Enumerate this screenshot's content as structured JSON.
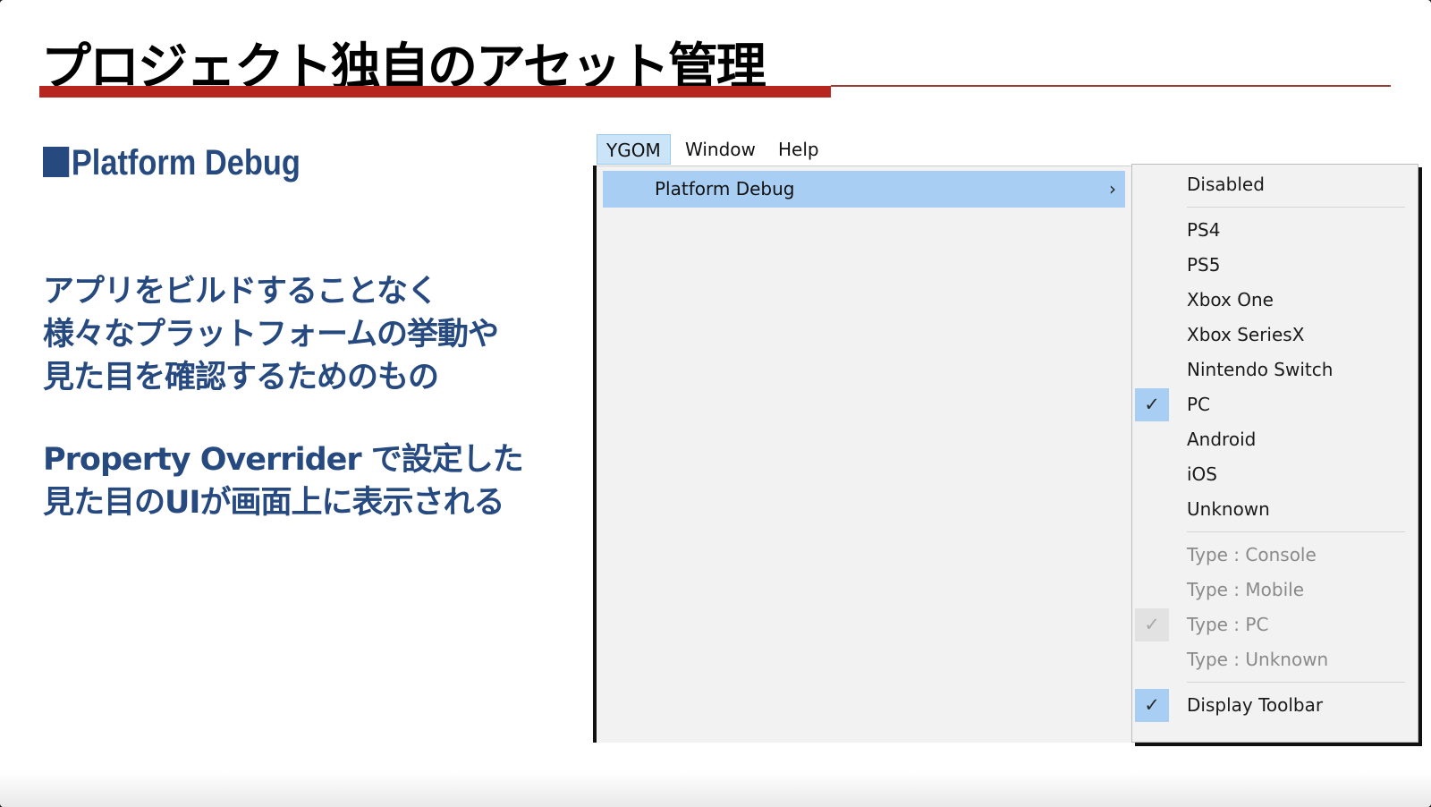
{
  "slide": {
    "title": "プロジェクト独自のアセット管理",
    "section_heading": "Platform Debug",
    "description_1": [
      "アプリをビルドすることなく",
      "様々なプラットフォームの挙動や",
      "見た目を確認するためのもの"
    ],
    "description_2": [
      "Property Overrider で設定した",
      "見た目のUIが画面上に表示される"
    ],
    "accent_color": "#b7251f",
    "text_color": "#264a80"
  },
  "menubar": {
    "items": [
      {
        "label": "YGOM",
        "active": true
      },
      {
        "label": "Window",
        "active": false
      },
      {
        "label": "Help",
        "active": false
      }
    ]
  },
  "main_menu": {
    "item": "Platform Debug",
    "arrow": "chevron-right-icon"
  },
  "submenu": {
    "items": [
      {
        "label": "Disabled",
        "checked": false,
        "enabled": true
      },
      {
        "label": "PS4",
        "checked": false,
        "enabled": true
      },
      {
        "label": "PS5",
        "checked": false,
        "enabled": true
      },
      {
        "label": "Xbox One",
        "checked": false,
        "enabled": true
      },
      {
        "label": "Xbox SeriesX",
        "checked": false,
        "enabled": true
      },
      {
        "label": "Nintendo Switch",
        "checked": false,
        "enabled": true
      },
      {
        "label": "PC",
        "checked": true,
        "enabled": true
      },
      {
        "label": "Android",
        "checked": false,
        "enabled": true
      },
      {
        "label": "iOS",
        "checked": false,
        "enabled": true
      },
      {
        "label": "Unknown",
        "checked": false,
        "enabled": true
      },
      {
        "label": "Type : Console",
        "checked": false,
        "enabled": false
      },
      {
        "label": "Type : Mobile",
        "checked": false,
        "enabled": false
      },
      {
        "label": "Type : PC",
        "checked": true,
        "enabled": false
      },
      {
        "label": "Type : Unknown",
        "checked": false,
        "enabled": false
      },
      {
        "label": "Display Toolbar",
        "checked": true,
        "enabled": true
      }
    ]
  }
}
